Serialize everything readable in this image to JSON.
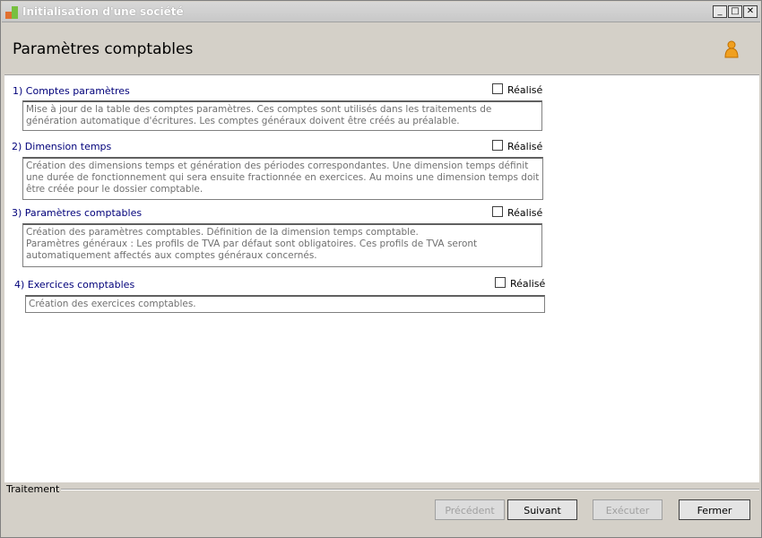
{
  "window": {
    "title": "Initialisation d'une société",
    "min_glyph": "_",
    "max_glyph": "□",
    "close_glyph": "✕"
  },
  "header": {
    "title": "Paramètres comptables"
  },
  "sections": [
    {
      "title": "1) Comptes paramètres",
      "check_label": "Réalisé",
      "checked": false,
      "description": "Mise à jour de la table des comptes paramètres. Ces comptes sont utilisés dans les traitements de génération automatique d'écritures. Les comptes généraux doivent être créés au préalable."
    },
    {
      "title": "2) Dimension temps",
      "check_label": "Réalisé",
      "checked": false,
      "description": "Création des dimensions temps et génération des périodes correspondantes. Une dimension temps définit une durée de fonctionnement qui sera ensuite fractionnée en exercices. Au moins une dimension temps doit être créée pour le dossier comptable."
    },
    {
      "title": "3) Paramètres comptables",
      "check_label": "Réalisé",
      "checked": false,
      "description": "Création des paramètres comptables. Définition de la dimension temps comptable.\nParamètres généraux : Les profils de TVA par défaut sont obligatoires. Ces profils de TVA seront automatiquement affectés aux comptes généraux concernés."
    },
    {
      "title": "4) Exercices comptables",
      "check_label": "Réalisé",
      "checked": false,
      "description": "Création des exercices comptables."
    }
  ],
  "footer": {
    "group_label": "Traitement",
    "buttons": {
      "previous": "Précédent",
      "next": "Suivant",
      "execute": "Exécuter",
      "close": "Fermer"
    }
  }
}
